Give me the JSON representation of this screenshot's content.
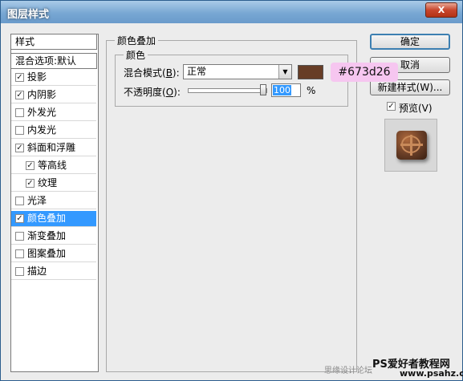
{
  "window": {
    "title": "图层样式",
    "close_label": "X"
  },
  "style_list": {
    "header": "样式",
    "blend_options": "混合选项:默认",
    "items": [
      {
        "label": "投影",
        "checked": true
      },
      {
        "label": "内阴影",
        "checked": true
      },
      {
        "label": "外发光",
        "checked": false
      },
      {
        "label": "内发光",
        "checked": false
      },
      {
        "label": "斜面和浮雕",
        "checked": true
      },
      {
        "label": "等高线",
        "checked": true
      },
      {
        "label": "纹理",
        "checked": true
      },
      {
        "label": "光泽",
        "checked": false
      },
      {
        "label": "颜色叠加",
        "checked": true,
        "selected": true
      },
      {
        "label": "渐变叠加",
        "checked": false
      },
      {
        "label": "图案叠加",
        "checked": false
      },
      {
        "label": "描边",
        "checked": false
      }
    ]
  },
  "panel": {
    "group_title": "颜色叠加",
    "sub_title": "颜色",
    "blend_mode_label": "混合模式(",
    "blend_mode_key": "B",
    "blend_mode_suffix": "):",
    "blend_mode_value": "正常",
    "opacity_label": "不透明度(",
    "opacity_key": "O",
    "opacity_suffix": "):",
    "opacity_value": "100",
    "opacity_unit": "%",
    "opacity_fraction": 1.0
  },
  "color": {
    "swatch": "#673d26",
    "callout_text": "#673d26",
    "callout_bg": "#f6c6f0"
  },
  "buttons": {
    "ok": "确定",
    "cancel": "取消",
    "new_style": "新建样式(W)...",
    "preview_label": "预览(V)",
    "preview_checked": true
  },
  "watermark": {
    "left": "思缘设计论坛",
    "brand": "PS爱好者教程网",
    "url": "www.psahz.com"
  }
}
